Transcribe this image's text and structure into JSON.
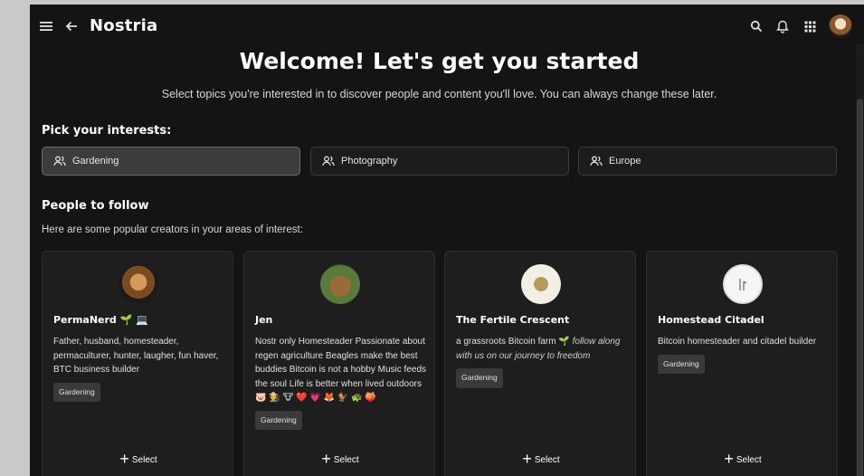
{
  "app": {
    "title": "Nostria"
  },
  "header": {
    "title": "Welcome! Let's get you started",
    "subtitle": "Select topics you're interested in to discover people and content you'll love. You can always change these later."
  },
  "interests": {
    "heading": "Pick your interests:",
    "items": [
      {
        "label": "Gardening",
        "selected": true
      },
      {
        "label": "Photography",
        "selected": false
      },
      {
        "label": "Europe",
        "selected": false
      }
    ]
  },
  "people": {
    "heading": "People to follow",
    "subtitle": "Here are some popular creators in your areas of interest:",
    "select_label": "Select",
    "cards": [
      {
        "name": "PermaNerd",
        "name_emoji": "🌱 💻",
        "bio": "Father, husband, homesteader, permaculturer, hunter, laugher, fun haver, BTC business builder",
        "bio_italic": "",
        "tag": "Gardening"
      },
      {
        "name": "Jen",
        "name_emoji": "",
        "bio": "Nostr only Homesteader Passionate about regen agriculture Beagles make the best buddies Bitcoin is not a hobby Music feeds the soul Life is better when lived outdoors 🐷 🧑‍🌾 🐮 ❤️ 💗 🦊 🐓 🐢 🍑",
        "bio_italic": "",
        "tag": "Gardening"
      },
      {
        "name": "The Fertile Crescent",
        "name_emoji": "",
        "bio": "a grassroots Bitcoin farm 🌱 ",
        "bio_italic": "follow along with us on our journey to freedom",
        "tag": "Gardening"
      },
      {
        "name": "Homestead Citadel",
        "name_emoji": "",
        "bio": "Bitcoin homesteader and citadel builder",
        "bio_italic": "",
        "tag": "Gardening"
      }
    ]
  },
  "icons": {
    "menu": "menu-icon",
    "back": "arrow-left-icon",
    "search": "search-icon",
    "notifications": "bell-icon",
    "apps": "grid-icon",
    "interest": "group-icon",
    "add": "plus-icon"
  },
  "colors": {
    "background": "#141414",
    "card": "#1e1e1e",
    "selected": "#3c3c3c",
    "text": "#ffffff"
  }
}
